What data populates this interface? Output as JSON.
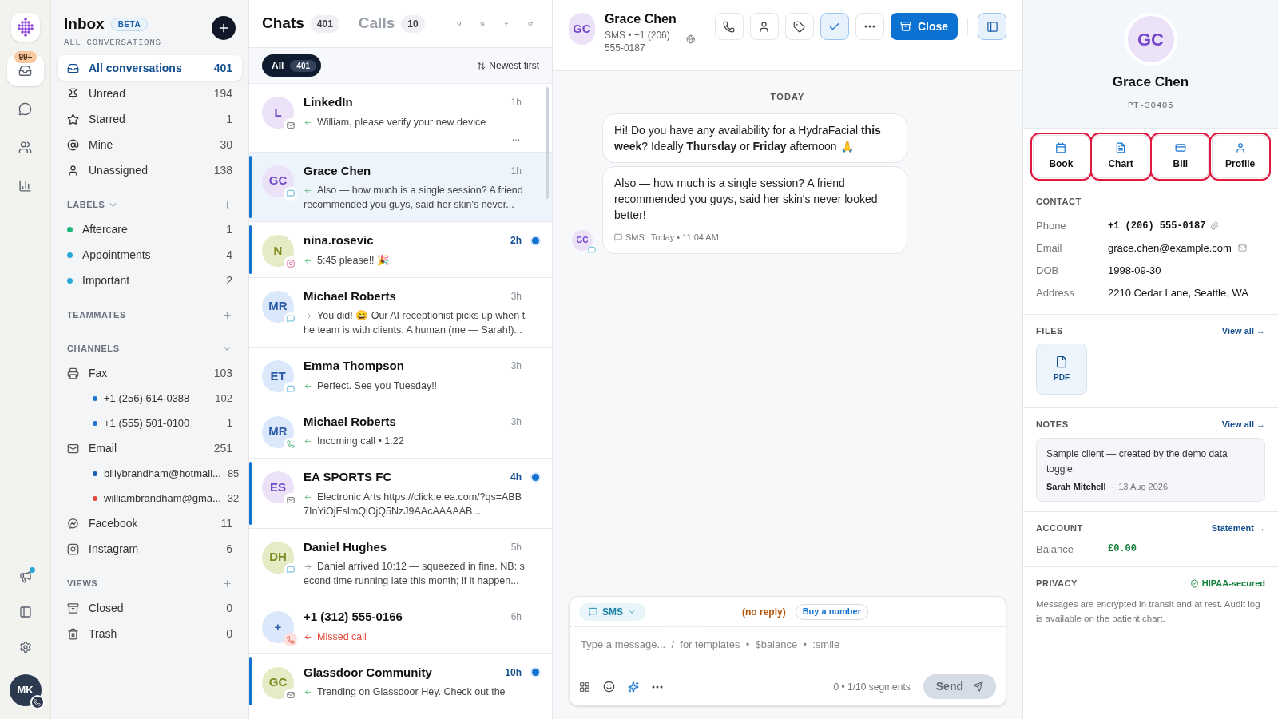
{
  "rail": {
    "items": [
      {
        "selected": true,
        "badge": "99+"
      },
      {
        "selected": false
      },
      {
        "selected": false
      },
      {
        "selected": false
      }
    ],
    "bottom": [
      {
        "dot": true
      },
      {
        "dot": false
      },
      {
        "dot": false
      }
    ],
    "user": {
      "initials": "MK"
    }
  },
  "sidebar": {
    "title": "Inbox",
    "badge": "BETA",
    "subtitle": "ALL CONVERSATIONS",
    "nav": [
      {
        "label": "All conversations",
        "count": "401",
        "selected": true
      },
      {
        "label": "Unread",
        "count": "194",
        "selected": false
      },
      {
        "label": "Starred",
        "count": "1",
        "selected": false
      },
      {
        "label": "Mine",
        "count": "30",
        "selected": false
      },
      {
        "label": "Unassigned",
        "count": "138",
        "selected": false
      }
    ],
    "sections": [
      {
        "title": "LABELS",
        "collapsible": true,
        "addable": true,
        "items": [
          {
            "kind": "label",
            "label": "Aftercare",
            "count": "1",
            "color": "#1fb87a"
          },
          {
            "kind": "label",
            "label": "Appointments",
            "count": "4",
            "color": "#2aa9d9"
          },
          {
            "kind": "label",
            "label": "Important",
            "count": "2",
            "color": "#2aa9d9"
          }
        ]
      },
      {
        "title": "TEAMMATES",
        "collapsible": false,
        "addable": true
      },
      {
        "title": "CHANNELS",
        "collapsible": true,
        "addable": false,
        "items": [
          {
            "kind": "fax",
            "label": "Fax",
            "count": "103",
            "children": [
              {
                "label": "+1 (256) 614-0388",
                "count": "102",
                "color": "#1a73d1"
              },
              {
                "label": "+1 (555) 501-0100",
                "count": "1",
                "color": "#1a73d1"
              }
            ]
          },
          {
            "kind": "email",
            "label": "Email",
            "count": "251",
            "children": [
              {
                "label": "billybrandham@hotmail...",
                "count": "85",
                "color": "#1a5fb4"
              },
              {
                "label": "williambrandham@gma...",
                "count": "32",
                "color": "#e5483b"
              }
            ]
          },
          {
            "kind": "messenger",
            "label": "Facebook",
            "count": "11"
          },
          {
            "kind": "instagram",
            "label": "Instagram",
            "count": "6"
          }
        ]
      },
      {
        "title": "VIEWS",
        "collapsible": false,
        "addable": true,
        "items": [
          {
            "kind": "archive",
            "label": "Closed",
            "count": "0"
          },
          {
            "kind": "trash",
            "label": "Trash",
            "count": "0"
          }
        ]
      }
    ]
  },
  "chats": {
    "tabs": [
      {
        "label": "Chats",
        "count": "401",
        "selected": true
      },
      {
        "label": "Calls",
        "count": "10",
        "selected": false
      }
    ],
    "filter": {
      "label": "All",
      "count": "401"
    },
    "sort": "Newest first",
    "items": [
      {
        "initials": "L",
        "color": "#ebe2f8",
        "kind": "email",
        "name": "LinkedIn",
        "time": "1h",
        "outgoing": false,
        "preview": "William, please verify your new device",
        "extra": "...",
        "unread": false,
        "selected": false
      },
      {
        "initials": "GC",
        "color": "#ebe2f8",
        "kind": "sms",
        "name": "Grace Chen",
        "time": "1h",
        "outgoing": false,
        "preview": "Also — how much is a single session? A friend recommended you guys, said her skin's never...",
        "unread": false,
        "selected": true
      },
      {
        "initials": "N",
        "color": "#e5ebc4",
        "kind": "instagram",
        "name": "nina.rosevic",
        "time": "2h",
        "outgoing": false,
        "preview": "5:45 please!! 🎉",
        "unread": true,
        "selected": false
      },
      {
        "initials": "MR",
        "color": "#dbe7fa",
        "kind": "sms",
        "name": "Michael Roberts",
        "time": "3h",
        "outgoing": true,
        "preview": "You did! 😄 Our AI receptionist picks up when the team is with clients. A human (me — Sarah!)...",
        "unread": false,
        "selected": false
      },
      {
        "initials": "ET",
        "color": "#dbe7fa",
        "kind": "sms",
        "name": "Emma Thompson",
        "time": "3h",
        "outgoing": false,
        "preview": "Perfect. See you Tuesday!!",
        "unread": false,
        "selected": false
      },
      {
        "initials": "MR",
        "color": "#dbe7fa",
        "kind": "call",
        "name": "Michael Roberts",
        "time": "3h",
        "outgoing": false,
        "preview": "Incoming call • 1:22",
        "unread": false,
        "selected": false
      },
      {
        "initials": "ES",
        "color": "#ebe2f8",
        "kind": "email",
        "name": "EA SPORTS FC",
        "time": "4h",
        "outgoing": false,
        "preview": "Electronic Arts https://click.e.ea.com/?qs=ABB7InYiOjEslmQiOjQ5NzJ9AAcAAAAAB...",
        "unread": true,
        "selected": false
      },
      {
        "initials": "DH",
        "color": "#e5ebc4",
        "kind": "sms",
        "name": "Daniel Hughes",
        "time": "5h",
        "outgoing": true,
        "preview": "Daniel arrived 10:12 — squeezed in fine. NB: second time running late this month; if it happen...",
        "unread": false,
        "selected": false
      },
      {
        "initials": "+",
        "color": "#dbe7fa",
        "kind": "missed",
        "name": "+1 (312) 555-0166",
        "time": "6h",
        "outgoing": false,
        "preview": "Missed call",
        "unread": false,
        "selected": false
      },
      {
        "initials": "GC",
        "color": "#e5ebc4",
        "kind": "email",
        "name": "Glassdoor Community",
        "time": "10h",
        "outgoing": false,
        "preview": "Trending on Glassdoor Hey. Check out the",
        "unread": true,
        "selected": false
      }
    ]
  },
  "conversation": {
    "initials": "GC",
    "name": "Grace Chen",
    "meta": "SMS • +1 (206) 555-0187",
    "actions": [
      {
        "selected": false
      },
      {
        "selected": false
      },
      {
        "selected": false
      },
      {
        "selected": true
      },
      {
        "selected": false
      }
    ],
    "close": "Close",
    "divider": "TODAY",
    "messages": [
      "Hi! Do you have any availability for a HydraFacial **this week**? Ideally **Thursday** or **Friday** afternoon 🙏",
      "Also — how much is a single session? A friend recommended you guys, said her skin's never looked better!"
    ],
    "message_meta": {
      "channel": "SMS",
      "time": "Today • 11:04 AM"
    },
    "sender_initials": "GC",
    "composer": {
      "channel": "SMS",
      "notice": "(no reply)",
      "buy": "Buy a number",
      "placeholder": "Type a message...  /  for templates  •  $balance  •  :smile",
      "counter": "0 • 1/10 segments",
      "send": "Send"
    }
  },
  "contact": {
    "initials": "GC",
    "name": "Grace Chen",
    "id": "PT-30405",
    "actions": [
      {
        "label": "Book",
        "highlighted": true
      },
      {
        "label": "Chart",
        "highlighted": true
      },
      {
        "label": "Bill",
        "highlighted": true
      },
      {
        "label": "Profile",
        "highlighted": true
      }
    ],
    "contact_title": "CONTACT",
    "fields": [
      {
        "kind": "phone",
        "label": "Phone",
        "value": "+1 (206) 555-0187"
      },
      {
        "kind": "email",
        "label": "Email",
        "value": "grace.chen@example.com"
      },
      {
        "kind": "text",
        "label": "DOB",
        "value": "1998-09-30"
      },
      {
        "kind": "text",
        "label": "Address",
        "value": "2210 Cedar Lane, Seattle, WA"
      }
    ],
    "files": {
      "title": "FILES",
      "link": "View all →",
      "items": [
        {
          "label": "PDF"
        }
      ]
    },
    "notes": {
      "title": "NOTES",
      "link": "View all →",
      "text": "Sample client — created by the demo data toggle.",
      "author": "Sarah Mitchell",
      "separator": "·",
      "date": "13 Aug 2026"
    },
    "account": {
      "title": "ACCOUNT",
      "link": "Statement →",
      "label": "Balance",
      "value": "£0.00"
    },
    "privacy": {
      "title": "PRIVACY",
      "badge": "HIPAA-secured",
      "text": "Messages are encrypted in transit and at rest. Audit log is available on the patient chart."
    }
  }
}
